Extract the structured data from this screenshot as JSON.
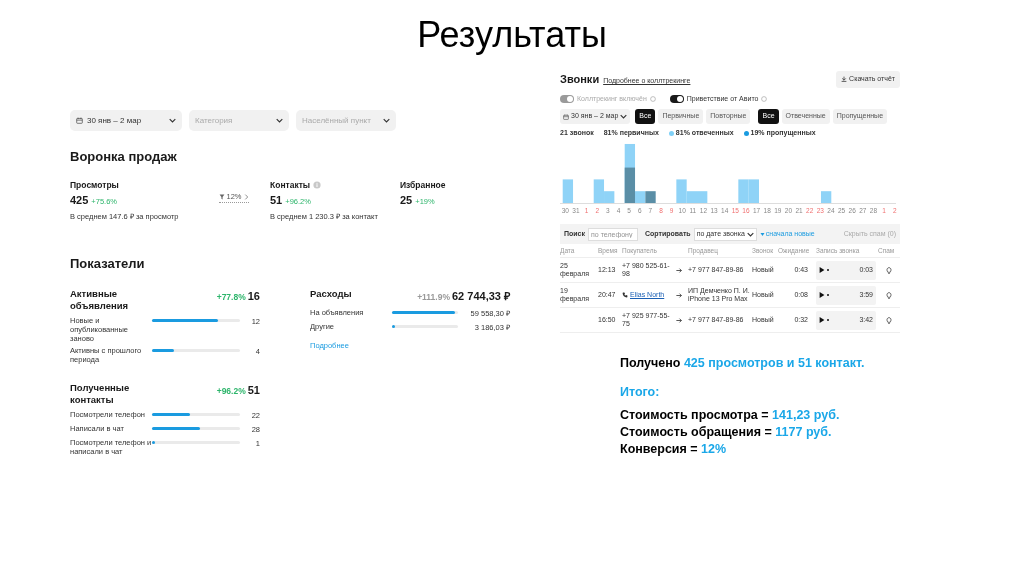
{
  "slide_title": "Результаты",
  "analytics": {
    "filters": [
      {
        "kind": "date",
        "value": "30 янв – 2 мар"
      },
      {
        "kind": "select",
        "placeholder": "Категория"
      },
      {
        "kind": "select",
        "placeholder": "Населённый пункт"
      }
    ],
    "funnel": {
      "title": "Воронка продаж",
      "conversion": "12%",
      "steps": [
        {
          "label": "Просмотры",
          "info": false,
          "value": "425",
          "change": "+75.6%",
          "note": "В среднем 147.6 ₽ за просмотр"
        },
        {
          "label": "Контакты",
          "info": true,
          "value": "51",
          "change": "+96.2%",
          "note": "В среднем 1 230.3 ₽ за контакт"
        },
        {
          "label": "Избранное",
          "info": false,
          "value": "25",
          "change": "+19%"
        }
      ]
    },
    "indicators": {
      "title": "Показатели",
      "cards": [
        {
          "title": "Активные объявления",
          "change": "+77.8%",
          "color": "#2db56b",
          "total": "16",
          "rows": [
            {
              "label": "Новые и опубликованные заново",
              "level": 0.75,
              "value": "12"
            },
            {
              "label": "Активны с прошлого периода",
              "level": 0.25,
              "value": "4"
            }
          ]
        },
        {
          "title": "Расходы",
          "change": "+111.9%",
          "color": "#999999",
          "total": "62 744,33 ₽",
          "rows": [
            {
              "label": "На объявления",
              "level": 0.95,
              "value": "59 558,30 ₽"
            },
            {
              "label": "Другие",
              "level": 0.05,
              "value": "3 186,03 ₽"
            }
          ],
          "link": "Подробнее"
        },
        {
          "title": "Полученные контакты",
          "change": "+96.2%",
          "color": "#2db56b",
          "total": "51",
          "rows": [
            {
              "label": "Посмотрели телефон",
              "level": 0.43,
              "value": "22"
            },
            {
              "label": "Написали в чат",
              "level": 0.55,
              "value": "28"
            },
            {
              "label": "Посмотрели телефон и написали в чат",
              "level": 0.03,
              "value": "1"
            }
          ]
        }
      ]
    }
  },
  "calls": {
    "title": "Звонки",
    "link": "Подробнее о коллтрекинге",
    "download_button": "Скачать отчёт",
    "toggles": [
      {
        "label": "Коллтрекинг включён",
        "on": true,
        "disabled": true
      },
      {
        "label": "Приветствие от Авито",
        "on": true,
        "disabled": false
      }
    ],
    "date_filter": "30 янв – 2 мар",
    "segment_groups": [
      [
        {
          "label": "Все",
          "selected": true
        },
        {
          "label": "Первичные",
          "selected": false
        },
        {
          "label": "Повторные",
          "selected": false
        }
      ],
      [
        {
          "label": "Все",
          "selected": true
        },
        {
          "label": "Отвеченные",
          "selected": false
        },
        {
          "label": "Пропущенные",
          "selected": false
        }
      ]
    ],
    "stats": [
      {
        "label": "21 звонок"
      },
      {
        "label": "81% первичных"
      },
      {
        "label": "81% отвеченных",
        "color": "#7fd0f7"
      },
      {
        "label": "19% пропущенных",
        "color": "#1a9be0"
      }
    ],
    "x_labels": [
      {
        "label": "30",
        "weekend": false
      },
      {
        "label": "31",
        "weekend": false
      },
      {
        "label": "1",
        "weekend": true
      },
      {
        "label": "2",
        "weekend": true
      },
      {
        "label": "3",
        "weekend": false
      },
      {
        "label": "4",
        "weekend": false
      },
      {
        "label": "5",
        "weekend": false
      },
      {
        "label": "6",
        "weekend": false
      },
      {
        "label": "7",
        "weekend": false
      },
      {
        "label": "8",
        "weekend": true
      },
      {
        "label": "9",
        "weekend": true
      },
      {
        "label": "10",
        "weekend": false
      },
      {
        "label": "11",
        "weekend": false
      },
      {
        "label": "12",
        "weekend": false
      },
      {
        "label": "13",
        "weekend": false
      },
      {
        "label": "14",
        "weekend": false
      },
      {
        "label": "15",
        "weekend": true
      },
      {
        "label": "16",
        "weekend": true
      },
      {
        "label": "17",
        "weekend": false
      },
      {
        "label": "18",
        "weekend": false
      },
      {
        "label": "19",
        "weekend": false
      },
      {
        "label": "20",
        "weekend": false
      },
      {
        "label": "21",
        "weekend": false
      },
      {
        "label": "22",
        "weekend": true
      },
      {
        "label": "23",
        "weekend": true
      },
      {
        "label": "24",
        "weekend": false
      },
      {
        "label": "25",
        "weekend": false
      },
      {
        "label": "26",
        "weekend": false
      },
      {
        "label": "27",
        "weekend": false
      },
      {
        "label": "28",
        "weekend": false
      },
      {
        "label": "1",
        "weekend": true
      },
      {
        "label": "2",
        "weekend": true
      }
    ],
    "table": {
      "search_label": "Поиск",
      "search_placeholder": "по телефону",
      "sort_label": "Сортировать",
      "sort_value": "по дате звонка",
      "order": "сначала новые",
      "hide_spam": "Скрыть спам (0)",
      "columns": [
        "Дата",
        "Время",
        "Покупатель",
        "Продавец",
        "Звонок",
        "Ожидание",
        "Запись звонка",
        "Спам"
      ],
      "rows": [
        {
          "date": "25 февраля",
          "time": "12:13",
          "buyer": "+7 980 525-61-98",
          "kind": "phone",
          "seller": "+7 977 847-89-86",
          "call": "Новый",
          "wait": "0:43",
          "duration": "0:03"
        },
        {
          "date": "19 февраля",
          "time": "20:47",
          "buyer": "Elias North",
          "kind": "profile",
          "seller": "ИП Демченко П. И. iPhone 13 Pro Max",
          "call": "Новый",
          "wait": "0:08",
          "duration": "3:59"
        },
        {
          "time": "16:50",
          "buyer": "+7 925 977-55-75",
          "kind": "phone",
          "seller": "+7 977 847-89-86",
          "call": "Новый",
          "wait": "0:32",
          "duration": "3:42"
        }
      ]
    }
  },
  "summary": [
    [
      {
        "text": "Получено ",
        "accent": false
      },
      {
        "text": "425 просмотров и 51 контакт.",
        "accent": true
      }
    ],
    [
      {
        "text": "Итого:",
        "accent": true
      }
    ],
    [
      {
        "text": "Стоимость просмотра = ",
        "accent": false
      },
      {
        "text": "141,23 руб.",
        "accent": true
      }
    ],
    [
      {
        "text": "Стоимость обращения = ",
        "accent": false
      },
      {
        "text": "1177 руб.",
        "accent": true
      }
    ],
    [
      {
        "text": "Конверсия = ",
        "accent": false
      },
      {
        "text": "12%",
        "accent": true
      }
    ]
  ]
}
